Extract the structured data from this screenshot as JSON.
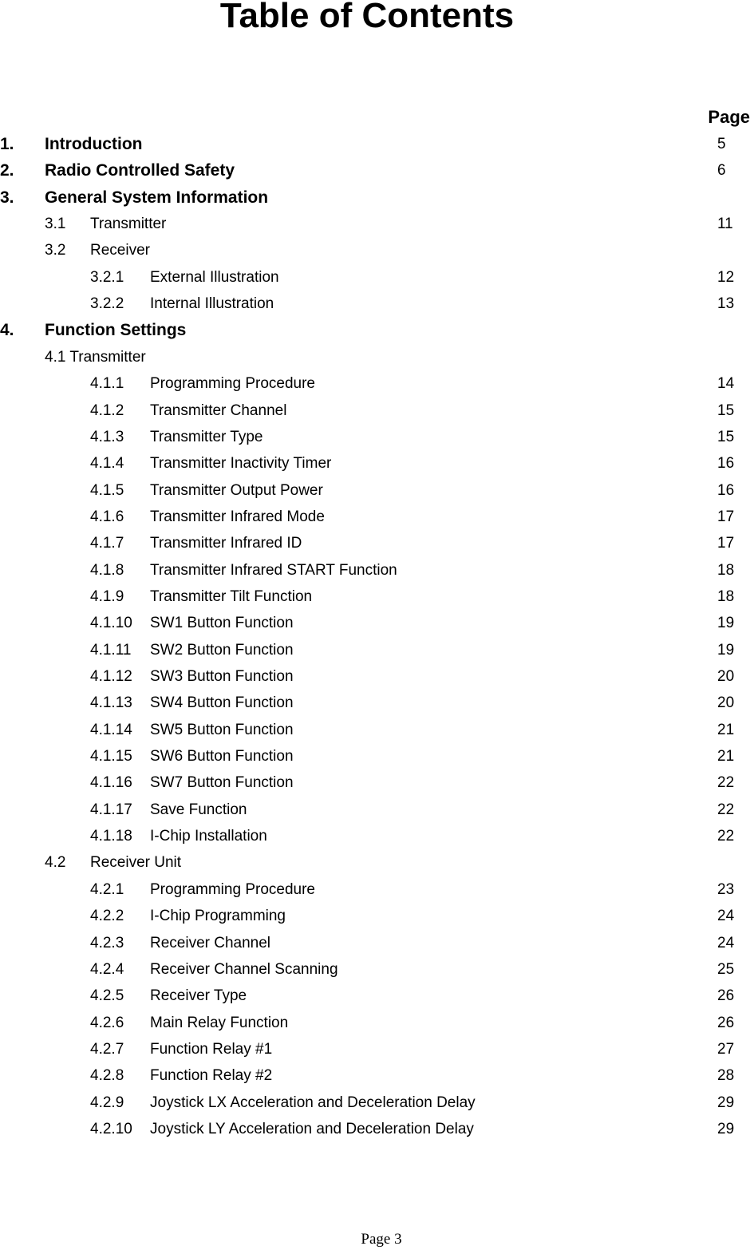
{
  "title": "Table of Contents",
  "page_column_header": "Page",
  "entries": [
    {
      "level": 1,
      "num": "1.",
      "label": "Introduction",
      "page": "5"
    },
    {
      "level": 1,
      "num": "2.",
      "label": "Radio Controlled Safety",
      "page": "6"
    },
    {
      "level": 1,
      "num": "3.",
      "label": "General System Information",
      "page": ""
    },
    {
      "level": 2,
      "num": "3.1",
      "label": "Transmitter",
      "page": "11"
    },
    {
      "level": 2,
      "num": "3.2",
      "label": "Receiver",
      "page": ""
    },
    {
      "level": 3,
      "num": "3.2.1",
      "label": "External Illustration",
      "page": "12"
    },
    {
      "level": 3,
      "num": "3.2.2",
      "label": "Internal Illustration",
      "page": "13"
    },
    {
      "level": 1,
      "num": "4.",
      "label": "Function Settings",
      "page": ""
    },
    {
      "level": "2b",
      "num": "4.1 Transmitter",
      "label": "",
      "page": ""
    },
    {
      "level": 3,
      "num": "4.1.1",
      "label": "Programming Procedure",
      "page": "14"
    },
    {
      "level": 3,
      "num": "4.1.2",
      "label": "Transmitter Channel",
      "page": "15"
    },
    {
      "level": 3,
      "num": "4.1.3",
      "label": "Transmitter Type",
      "page": "15"
    },
    {
      "level": 3,
      "num": "4.1.4",
      "label": "Transmitter Inactivity Timer",
      "page": "16"
    },
    {
      "level": 3,
      "num": "4.1.5",
      "label": "Transmitter Output Power",
      "page": "16"
    },
    {
      "level": 3,
      "num": "4.1.6",
      "label": "Transmitter Infrared Mode",
      "page": "17"
    },
    {
      "level": 3,
      "num": "4.1.7",
      "label": "Transmitter Infrared ID",
      "page": "17"
    },
    {
      "level": 3,
      "num": "4.1.8",
      "label": "Transmitter Infrared START Function",
      "page": "18"
    },
    {
      "level": 3,
      "num": "4.1.9",
      "label": "Transmitter Tilt Function",
      "page": "18"
    },
    {
      "level": 3,
      "num": "4.1.10",
      "label": "SW1 Button Function",
      "page": "19"
    },
    {
      "level": 3,
      "num": "4.1.11",
      "label": "SW2 Button Function",
      "page": "19"
    },
    {
      "level": 3,
      "num": "4.1.12",
      "label": "SW3 Button Function",
      "page": "20"
    },
    {
      "level": 3,
      "num": "4.1.13",
      "label": "SW4 Button Function",
      "page": "20"
    },
    {
      "level": 3,
      "num": "4.1.14",
      "label": "SW5 Button Function",
      "page": "21"
    },
    {
      "level": 3,
      "num": "4.1.15",
      "label": "SW6 Button Function",
      "page": "21"
    },
    {
      "level": 3,
      "num": "4.1.16",
      "label": "SW7 Button Function",
      "page": "22"
    },
    {
      "level": 3,
      "num": "4.1.17",
      "label": "Save Function",
      "page": "22"
    },
    {
      "level": 3,
      "num": "4.1.18",
      "label": "I-Chip Installation",
      "page": "22"
    },
    {
      "level": 2,
      "num": "4.2",
      "label": "Receiver Unit",
      "page": ""
    },
    {
      "level": 3,
      "num": "4.2.1",
      "label": "Programming Procedure",
      "page": "23"
    },
    {
      "level": 3,
      "num": "4.2.2",
      "label": "I-Chip Programming",
      "page": "24"
    },
    {
      "level": 3,
      "num": "4.2.3",
      "label": "Receiver Channel",
      "page": "24"
    },
    {
      "level": 3,
      "num": "4.2.4",
      "label": "Receiver Channel Scanning",
      "page": "25"
    },
    {
      "level": 3,
      "num": "4.2.5",
      "label": "Receiver Type",
      "page": "26"
    },
    {
      "level": 3,
      "num": "4.2.6",
      "label": "Main Relay Function",
      "page": "26"
    },
    {
      "level": 3,
      "num": "4.2.7",
      "label": "Function Relay #1",
      "page": "27"
    },
    {
      "level": 3,
      "num": "4.2.8",
      "label": "Function Relay #2",
      "page": "28"
    },
    {
      "level": 3,
      "num": "4.2.9",
      "label": "Joystick LX Acceleration and Deceleration Delay",
      "page": "29"
    },
    {
      "level": 3,
      "num": "4.2.10",
      "label": "Joystick LY Acceleration and Deceleration Delay",
      "page": "29"
    }
  ],
  "footer": "Page 3"
}
